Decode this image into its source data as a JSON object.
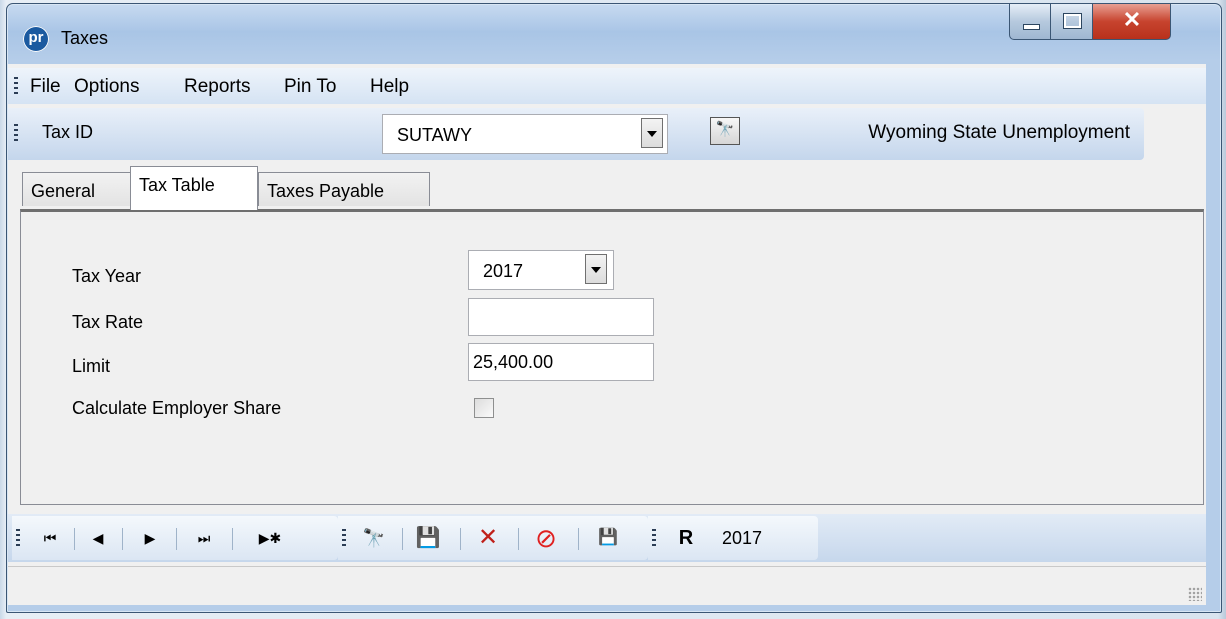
{
  "window": {
    "title": "Taxes",
    "app_icon_text": "pr"
  },
  "menu": {
    "items": [
      "File",
      "Options",
      "Reports",
      "Pin To",
      "Help"
    ]
  },
  "tax_id_bar": {
    "label": "Tax ID",
    "value": "SUTAWY",
    "description": "Wyoming State Unemployment"
  },
  "tabs": [
    "General",
    "Tax Table",
    "Taxes Payable"
  ],
  "active_tab": "Tax Table",
  "form": {
    "tax_year_label": "Tax Year",
    "tax_year_value": "2017",
    "tax_rate_label": "Tax Rate",
    "tax_rate_value": "",
    "limit_label": "Limit",
    "limit_value": "25,400.00",
    "employer_share_label": "Calculate Employer Share",
    "employer_share_checked": false
  },
  "toolbar": {
    "year": "2017"
  },
  "colors": {
    "accent_blue": "#1b5aa0",
    "delete_red": "#c0201a",
    "cancel_red": "#e02020"
  }
}
